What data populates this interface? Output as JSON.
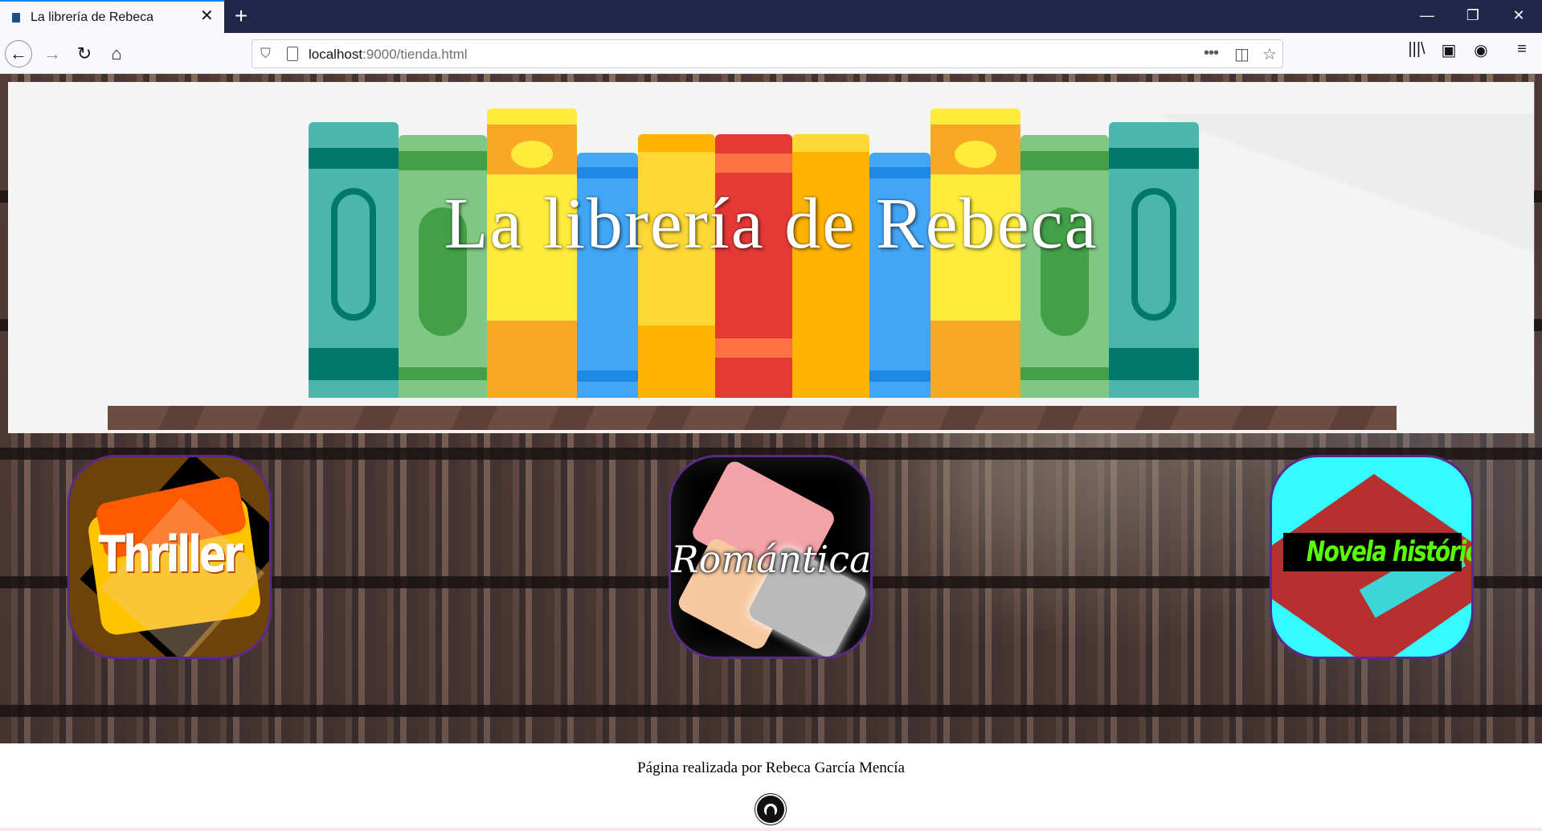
{
  "browser": {
    "tab_title": "La librería de Rebeca",
    "tab_close": "✕",
    "new_tab": "+",
    "url_host": "localhost",
    "url_rest": ":9000/tienda.html",
    "window_controls": {
      "minimize": "—",
      "maximize": "❐",
      "close": "✕"
    },
    "nav": {
      "back": "←",
      "forward": "→",
      "reload": "↻",
      "home": "⌂"
    },
    "url_icons": {
      "more": "•••",
      "pocket": "◫",
      "bookmark": "☆"
    },
    "toolbar": {
      "library": "|||\\",
      "sidebar": "▣",
      "account": "◉",
      "menu": "≡"
    }
  },
  "banner": {
    "title": "La librería de Rebeca"
  },
  "categories": [
    {
      "label": "Thriller"
    },
    {
      "label": "Romántica"
    },
    {
      "label": "Novela histórica"
    }
  ],
  "footer": {
    "credit": "Página realizada por Rebeca García Mencía"
  },
  "colors": {
    "tabbar": "#1f2647",
    "accent": "#0a84ff",
    "category_border": "#5b2a86",
    "historic_label": "#57ff00"
  }
}
